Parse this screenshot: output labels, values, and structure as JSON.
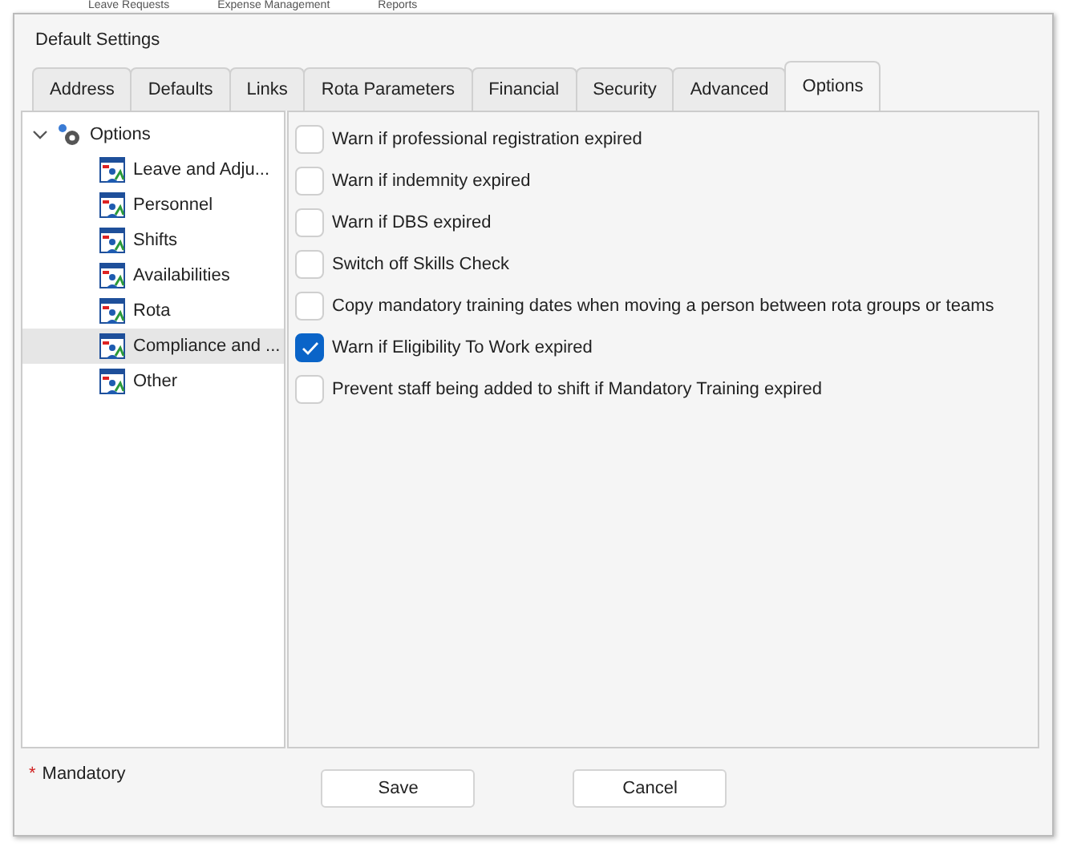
{
  "background_tabs": [
    {
      "label": "Leave Requests"
    },
    {
      "label": "Expense Management"
    },
    {
      "label": "Reports"
    }
  ],
  "window": {
    "title": "Default Settings"
  },
  "tabs": [
    {
      "label": "Address",
      "selected": false
    },
    {
      "label": "Defaults",
      "selected": false
    },
    {
      "label": "Links",
      "selected": false
    },
    {
      "label": "Rota Parameters",
      "selected": false
    },
    {
      "label": "Financial",
      "selected": false
    },
    {
      "label": "Security",
      "selected": false
    },
    {
      "label": "Advanced",
      "selected": false
    },
    {
      "label": "Options",
      "selected": true
    }
  ],
  "tree": {
    "label": "Options",
    "expanded": true,
    "children": [
      {
        "label": "Leave and Adju...",
        "selected": false
      },
      {
        "label": "Personnel",
        "selected": false
      },
      {
        "label": "Shifts",
        "selected": false
      },
      {
        "label": "Availabilities",
        "selected": false
      },
      {
        "label": "Rota",
        "selected": false
      },
      {
        "label": "Compliance and ...",
        "selected": true
      },
      {
        "label": "Other",
        "selected": false
      }
    ]
  },
  "options": [
    {
      "label": "Warn if professional registration expired",
      "checked": false
    },
    {
      "label": "Warn if indemnity expired",
      "checked": false
    },
    {
      "label": "Warn if DBS expired",
      "checked": false
    },
    {
      "label": "Switch off Skills Check",
      "checked": false
    },
    {
      "label": "Copy mandatory training dates when moving a person between rota groups or teams",
      "checked": false
    },
    {
      "label": "Warn if Eligibility To Work expired",
      "checked": true
    },
    {
      "label": "Prevent staff being added to shift if Mandatory Training expired",
      "checked": false
    }
  ],
  "footer": {
    "required_mark": "*",
    "required_label": "Mandatory",
    "buttons": [
      "Save",
      "Cancel"
    ]
  }
}
